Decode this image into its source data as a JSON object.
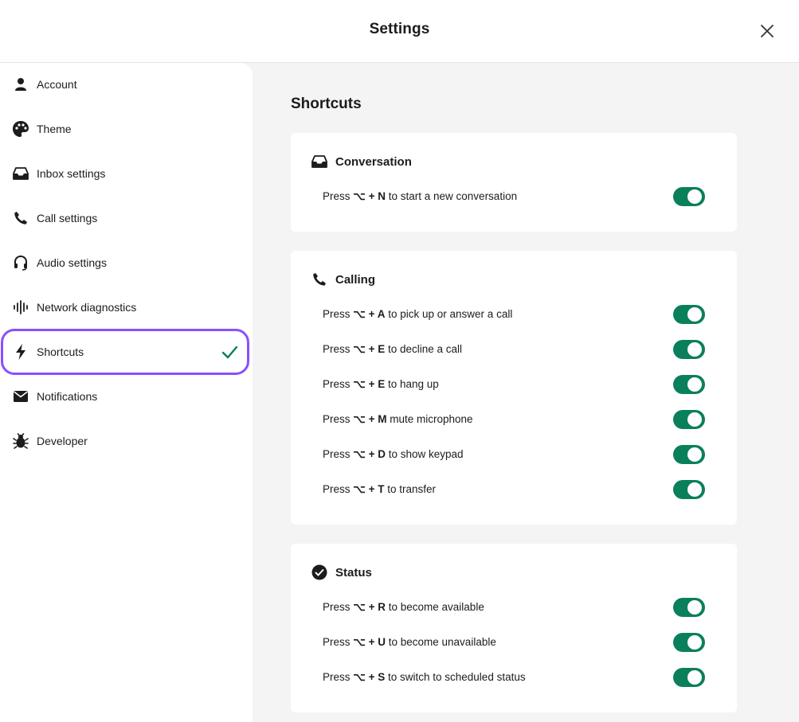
{
  "header": {
    "title": "Settings",
    "close_icon": "close-icon"
  },
  "sidebar": {
    "items": [
      {
        "label": "Account",
        "icon": "person-icon"
      },
      {
        "label": "Theme",
        "icon": "palette-icon"
      },
      {
        "label": "Inbox settings",
        "icon": "inbox-icon"
      },
      {
        "label": "Call settings",
        "icon": "phone-icon"
      },
      {
        "label": "Audio settings",
        "icon": "headphones-icon"
      },
      {
        "label": "Network diagnostics",
        "icon": "waveform-icon"
      },
      {
        "label": "Shortcuts",
        "icon": "bolt-icon",
        "active": true
      },
      {
        "label": "Notifications",
        "icon": "envelope-icon"
      },
      {
        "label": "Developer",
        "icon": "bug-icon"
      }
    ],
    "active_check_icon": "checkmark-icon"
  },
  "content": {
    "title": "Shortcuts",
    "cards": [
      {
        "title": "Conversation",
        "icon": "inbox-icon",
        "rows": [
          {
            "prefix": "Press",
            "keys": "⌥ + N",
            "suffix": "to start a new conversation",
            "enabled": true
          }
        ]
      },
      {
        "title": "Calling",
        "icon": "phone-icon",
        "rows": [
          {
            "prefix": "Press",
            "keys": "⌥ + A",
            "suffix": "to pick up or answer a call",
            "enabled": true
          },
          {
            "prefix": "Press",
            "keys": "⌥ + E",
            "suffix": "to decline a call",
            "enabled": true
          },
          {
            "prefix": "Press",
            "keys": "⌥ + E",
            "suffix": "to hang up",
            "enabled": true
          },
          {
            "prefix": "Press",
            "keys": "⌥ + M",
            "suffix": "mute microphone",
            "enabled": true
          },
          {
            "prefix": "Press",
            "keys": "⌥ + D",
            "suffix": "to show keypad",
            "enabled": true
          },
          {
            "prefix": "Press",
            "keys": "⌥ + T",
            "suffix": "to transfer",
            "enabled": true
          }
        ]
      },
      {
        "title": "Status",
        "icon": "check-circle-icon",
        "rows": [
          {
            "prefix": "Press",
            "keys": "⌥ + R",
            "suffix": "to become available",
            "enabled": true
          },
          {
            "prefix": "Press",
            "keys": "⌥ + U",
            "suffix": "to become unavailable",
            "enabled": true
          },
          {
            "prefix": "Press",
            "keys": "⌥ + S",
            "suffix": "to switch to scheduled status",
            "enabled": true
          }
        ]
      }
    ]
  },
  "colors": {
    "accent": "#0a7f5b",
    "active_outline": "#8a4fff"
  }
}
